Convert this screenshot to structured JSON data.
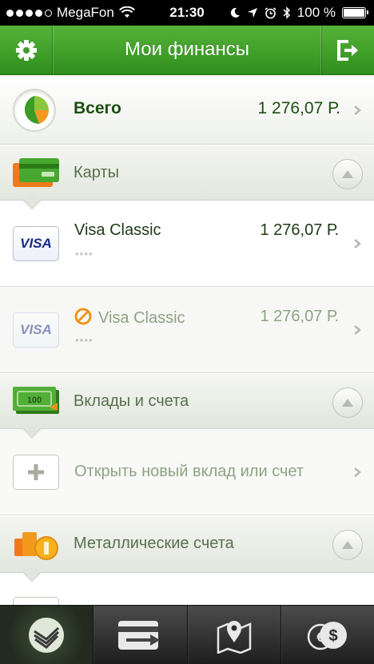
{
  "status_bar": {
    "carrier": "MegaFon",
    "time": "21:30",
    "battery": "100 %"
  },
  "nav": {
    "title": "Мои финансы",
    "left_icon": "gear-icon",
    "right_icon": "logout-icon"
  },
  "total": {
    "label": "Всего",
    "amount": "1 276,07 Р."
  },
  "sections": {
    "cards": {
      "label": "Карты",
      "icon": "cards-icon"
    },
    "deposits": {
      "label": "Вклады и счета",
      "icon": "banknote-icon"
    },
    "metals": {
      "label": "Металлические счета",
      "icon": "coins-icon"
    }
  },
  "cards": [
    {
      "name": "Visa Classic",
      "amount": "1 276,07 Р.",
      "mask": "****",
      "logo": "VISA",
      "blocked": false
    },
    {
      "name": "Visa Classic",
      "amount": "1 276,07 Р.",
      "mask": "****",
      "logo": "VISA",
      "blocked": true
    }
  ],
  "deposits": {
    "open_label": "Открыть новый вклад или счет"
  },
  "tabbar": {
    "tabs": [
      {
        "icon": "sber-logo-icon",
        "active": true
      },
      {
        "icon": "transfer-icon",
        "active": false
      },
      {
        "icon": "map-pin-icon",
        "active": false
      },
      {
        "icon": "currency-icon",
        "active": false
      }
    ]
  },
  "colors": {
    "accent_green": "#3a9c25",
    "dark_green_text": "#1d4e12",
    "muted_green_text": "#8ea383",
    "visa_blue": "#1a2d8a"
  }
}
